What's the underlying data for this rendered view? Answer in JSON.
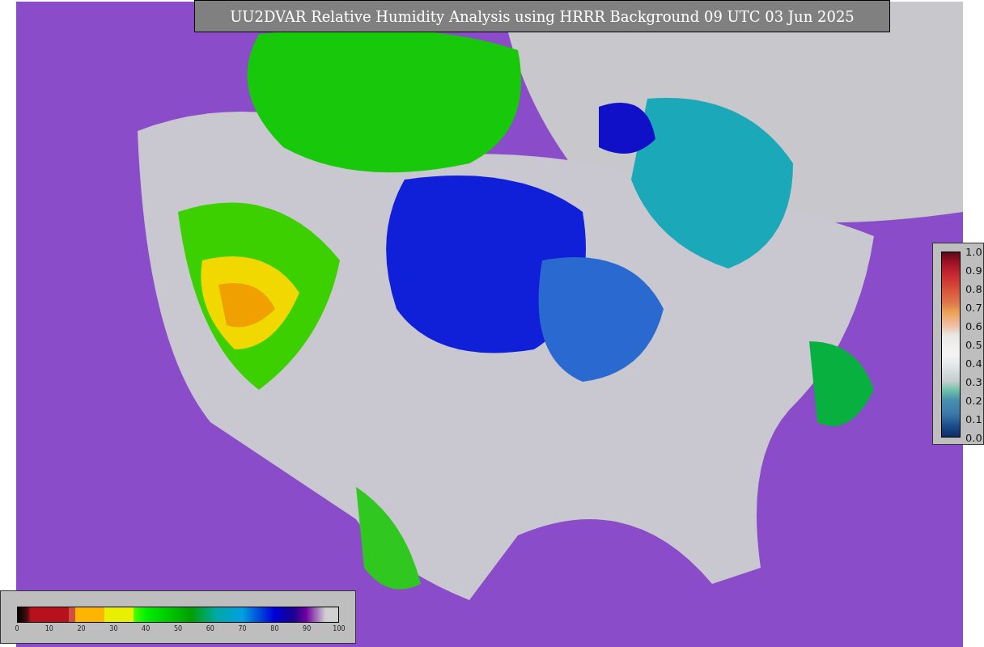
{
  "title": "UU2DVAR Relative Humidity Analysis using HRRR Background 09 UTC 03 Jun 2025",
  "humidity_colorbar": {
    "ticks": [
      "0",
      "10",
      "20",
      "30",
      "40",
      "50",
      "60",
      "70",
      "80",
      "90",
      "100"
    ]
  },
  "ratio_colorbar": {
    "ticks": [
      "1.0",
      "0.9",
      "0.8",
      "0.7",
      "0.6",
      "0.5",
      "0.4",
      "0.3",
      "0.2",
      "0.1",
      "0.0"
    ]
  }
}
